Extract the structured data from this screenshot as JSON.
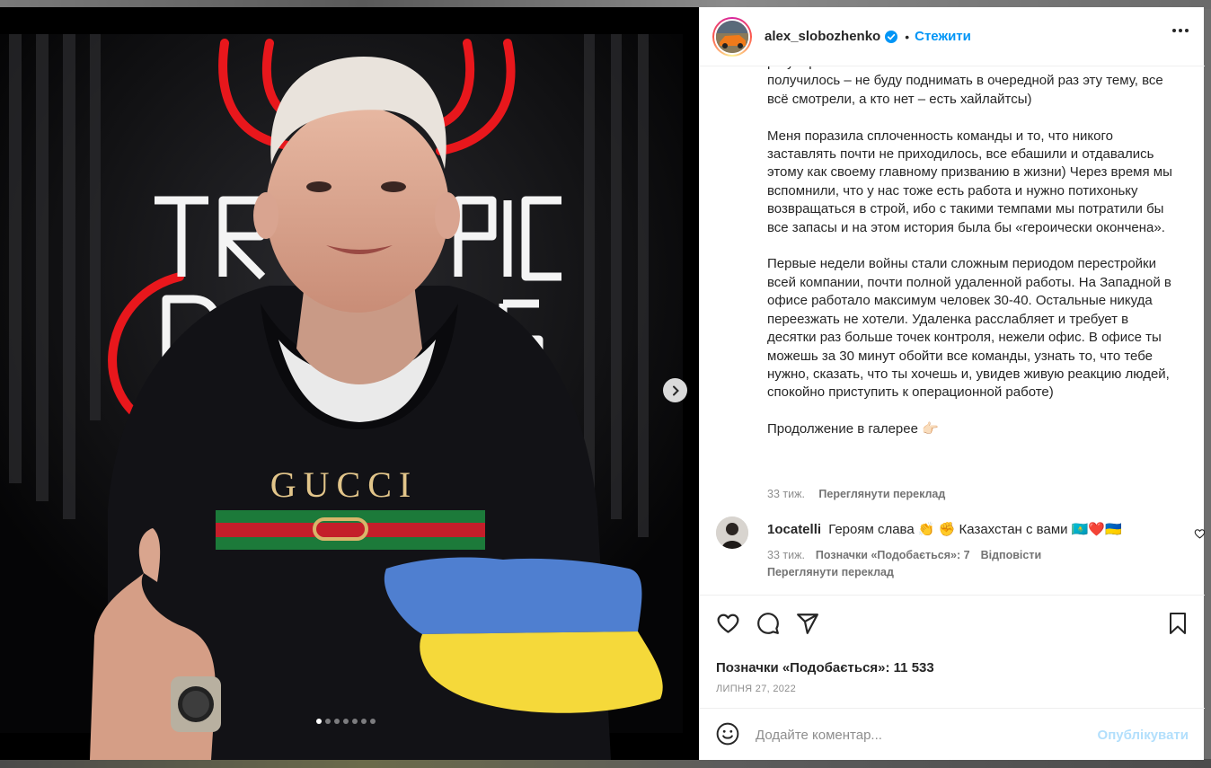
{
  "post": {
    "username": "alex_slobozhenko",
    "follow_separator": "•",
    "follow_label": "Стежити",
    "caption_text": "регулярно… …\nполучилось – не буду поднимать в очередной раз эту тему, все всё смотрели, а кто нет – есть хайлайтсы)\n\nМеня поразила сплоченность команды и то, что никого заставлять почти не приходилось, все ебашили и отдавались этому как своему главному призванию в жизни) Через время мы вспомнили, что у нас тоже есть работа и нужно потихоньку возвращаться в строй, ибо с такими темпами мы потратили бы все запасы и на этом история была бы «героически окончена».\n\nПервые недели войны стали сложным периодом перестройки всей компании, почти полной удаленной работы. На Западной в офисе работало максимум человек 30-40. Остальные никуда переезжать не хотели. Удаленка расслабляет и требует в десятки раз больше точек контроля, нежели офис. В офисе ты можешь за 30 минут обойти все команды, узнать то, что тебе нужно, сказать, что ты хочешь и, увидев живую реакцию людей, спокойно приступить к операционной работе)\n\nПродолжение в галерее 👉🏻",
    "caption_age": "33 тиж.",
    "caption_translate": "Переглянути переклад",
    "likes_text": "Позначки «Подобається»: 11 533",
    "date": "ЛИПНЯ 27, 2022"
  },
  "media": {
    "slide_count": 7,
    "active_slide": 1,
    "neon_sign_text": "TRAFIC DEVILS",
    "hoodie_text": "GUCCI"
  },
  "comment": {
    "username": "1ocatelli",
    "text": "Героям слава 👏 ✊  Казахстан с вами 🇰🇿❤️🇺🇦",
    "age": "33 тиж.",
    "likes": "Позначки «Подобається»: 7",
    "reply": "Відповісти",
    "translate": "Переглянути переклад"
  },
  "comment_box": {
    "placeholder": "Додайте коментар...",
    "publish_label": "Опублікувати"
  },
  "icons": [
    "verified-badge-icon",
    "more-options-icon",
    "chevron-right-icon",
    "heart-icon",
    "comment-icon",
    "share-icon",
    "bookmark-icon",
    "emoji-icon"
  ],
  "colors": {
    "accent": "#0095f6",
    "publish_disabled": "#b2dffc",
    "muted": "#8e8e8e",
    "flag_blue": "#4f7fd0",
    "flag_yellow": "#f5d93a",
    "neon_red": "#e8171c"
  }
}
